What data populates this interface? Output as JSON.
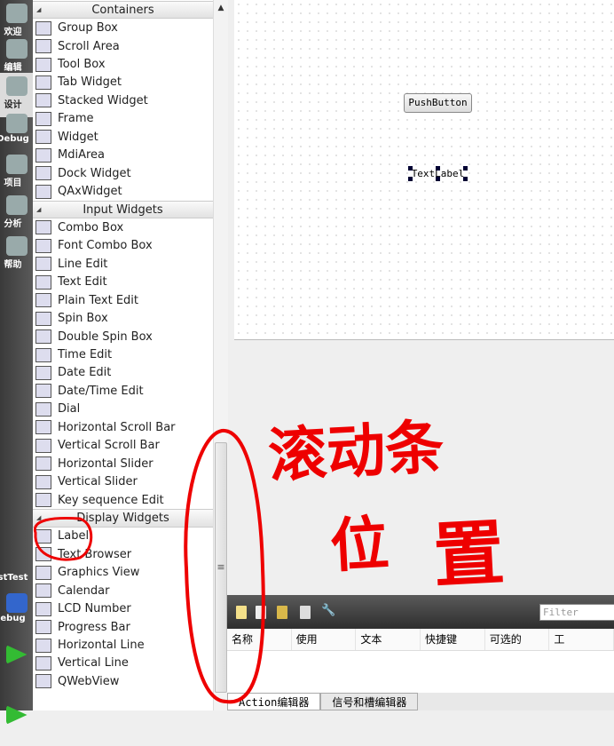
{
  "modebar": {
    "items": [
      {
        "label": "欢迎"
      },
      {
        "label": "编辑"
      },
      {
        "label": "设计",
        "active": true
      },
      {
        "label": "Debug"
      },
      {
        "label": "项目"
      },
      {
        "label": "分析"
      },
      {
        "label": "帮助"
      }
    ],
    "project": "stTest",
    "run_mode": "ebug"
  },
  "widgetbox": {
    "sections": [
      {
        "title": "Containers",
        "items": [
          "Group Box",
          "Scroll Area",
          "Tool Box",
          "Tab Widget",
          "Stacked Widget",
          "Frame",
          "Widget",
          "MdiArea",
          "Dock Widget",
          "QAxWidget"
        ]
      },
      {
        "title": "Input Widgets",
        "items": [
          "Combo Box",
          "Font Combo Box",
          "Line Edit",
          "Text Edit",
          "Plain Text Edit",
          "Spin Box",
          "Double Spin Box",
          "Time Edit",
          "Date Edit",
          "Date/Time Edit",
          "Dial",
          "Horizontal Scroll Bar",
          "Vertical Scroll Bar",
          "Horizontal Slider",
          "Vertical Slider",
          "Key sequence Edit"
        ]
      },
      {
        "title": "Display Widgets",
        "items": [
          "Label",
          "Text Browser",
          "Graphics View",
          "Calendar",
          "LCD Number",
          "Progress Bar",
          "Horizontal Line",
          "Vertical Line",
          "QWebView"
        ]
      }
    ],
    "scroll_grip": "≡",
    "scroll_up": "▲"
  },
  "form": {
    "push_button": "PushButton",
    "text_label": "TextLabel"
  },
  "action_editor": {
    "filter_placeholder": "Filter",
    "columns": [
      "名称",
      "使用",
      "文本",
      "快捷键",
      "可选的",
      "工"
    ]
  },
  "bottom_tabs": [
    "Action编辑器",
    "信号和槽编辑器"
  ],
  "annotation": {
    "line1": "滚动条",
    "line2a": "位",
    "line2b": "置",
    "color": "#e00000"
  }
}
